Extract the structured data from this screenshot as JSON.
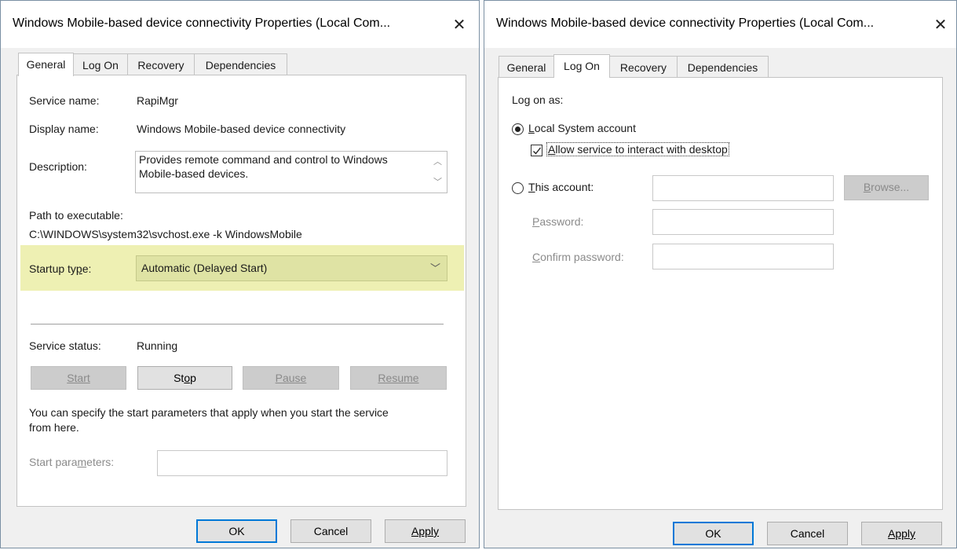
{
  "left": {
    "title": "Windows Mobile-based device connectivity Properties (Local Com...",
    "tabs": [
      "General",
      "Log On",
      "Recovery",
      "Dependencies"
    ],
    "service_name_label": "Service name:",
    "service_name_value": "RapiMgr",
    "display_name_label": "Display name:",
    "display_name_value": "Windows Mobile-based device connectivity",
    "description_label": "Description:",
    "description_line1": "Provides remote command and control to Windows",
    "description_line2": "Mobile-based devices.",
    "path_label": "Path to executable:",
    "path_value": "C:\\WINDOWS\\system32\\svchost.exe -k WindowsMobile",
    "startup_label_pre": "Startup ty",
    "startup_label_key": "p",
    "startup_label_post": "e:",
    "startup_value": "Automatic (Delayed Start)",
    "status_label": "Service status:",
    "status_value": "Running",
    "start_btn": "Start",
    "stop_btn_pre": "St",
    "stop_btn_key": "o",
    "stop_btn_post": "p",
    "pause_btn": "Pause",
    "resume_btn": "Resume",
    "hint_line1": "You can specify the start parameters that apply when you start the service",
    "hint_line2": "from here.",
    "params_label_pre": "Start para",
    "params_label_key": "m",
    "params_label_post": "eters:",
    "ok": "OK",
    "cancel": "Cancel",
    "apply": "Apply"
  },
  "right": {
    "title": "Windows Mobile-based device connectivity Properties (Local Com...",
    "tabs": [
      "General",
      "Log On",
      "Recovery",
      "Dependencies"
    ],
    "logon_as": "Log on as:",
    "local_system": "Local System account",
    "local_system_key": "L",
    "local_system_rest": "ocal System account",
    "allow_interact_key": "A",
    "allow_interact_rest": "llow service to interact with desktop",
    "this_account_key": "T",
    "this_account_rest": "his account:",
    "browse_key": "B",
    "browse_rest": "rowse...",
    "password_key": "P",
    "password_rest": "assword:",
    "confirm_key": "C",
    "confirm_rest": "onfirm password:",
    "ok": "OK",
    "cancel": "Cancel",
    "apply": "Apply"
  },
  "colors": {
    "highlight": "#eef0b3",
    "select_bg": "#dfe3a4",
    "focus_border": "#0078d7"
  }
}
